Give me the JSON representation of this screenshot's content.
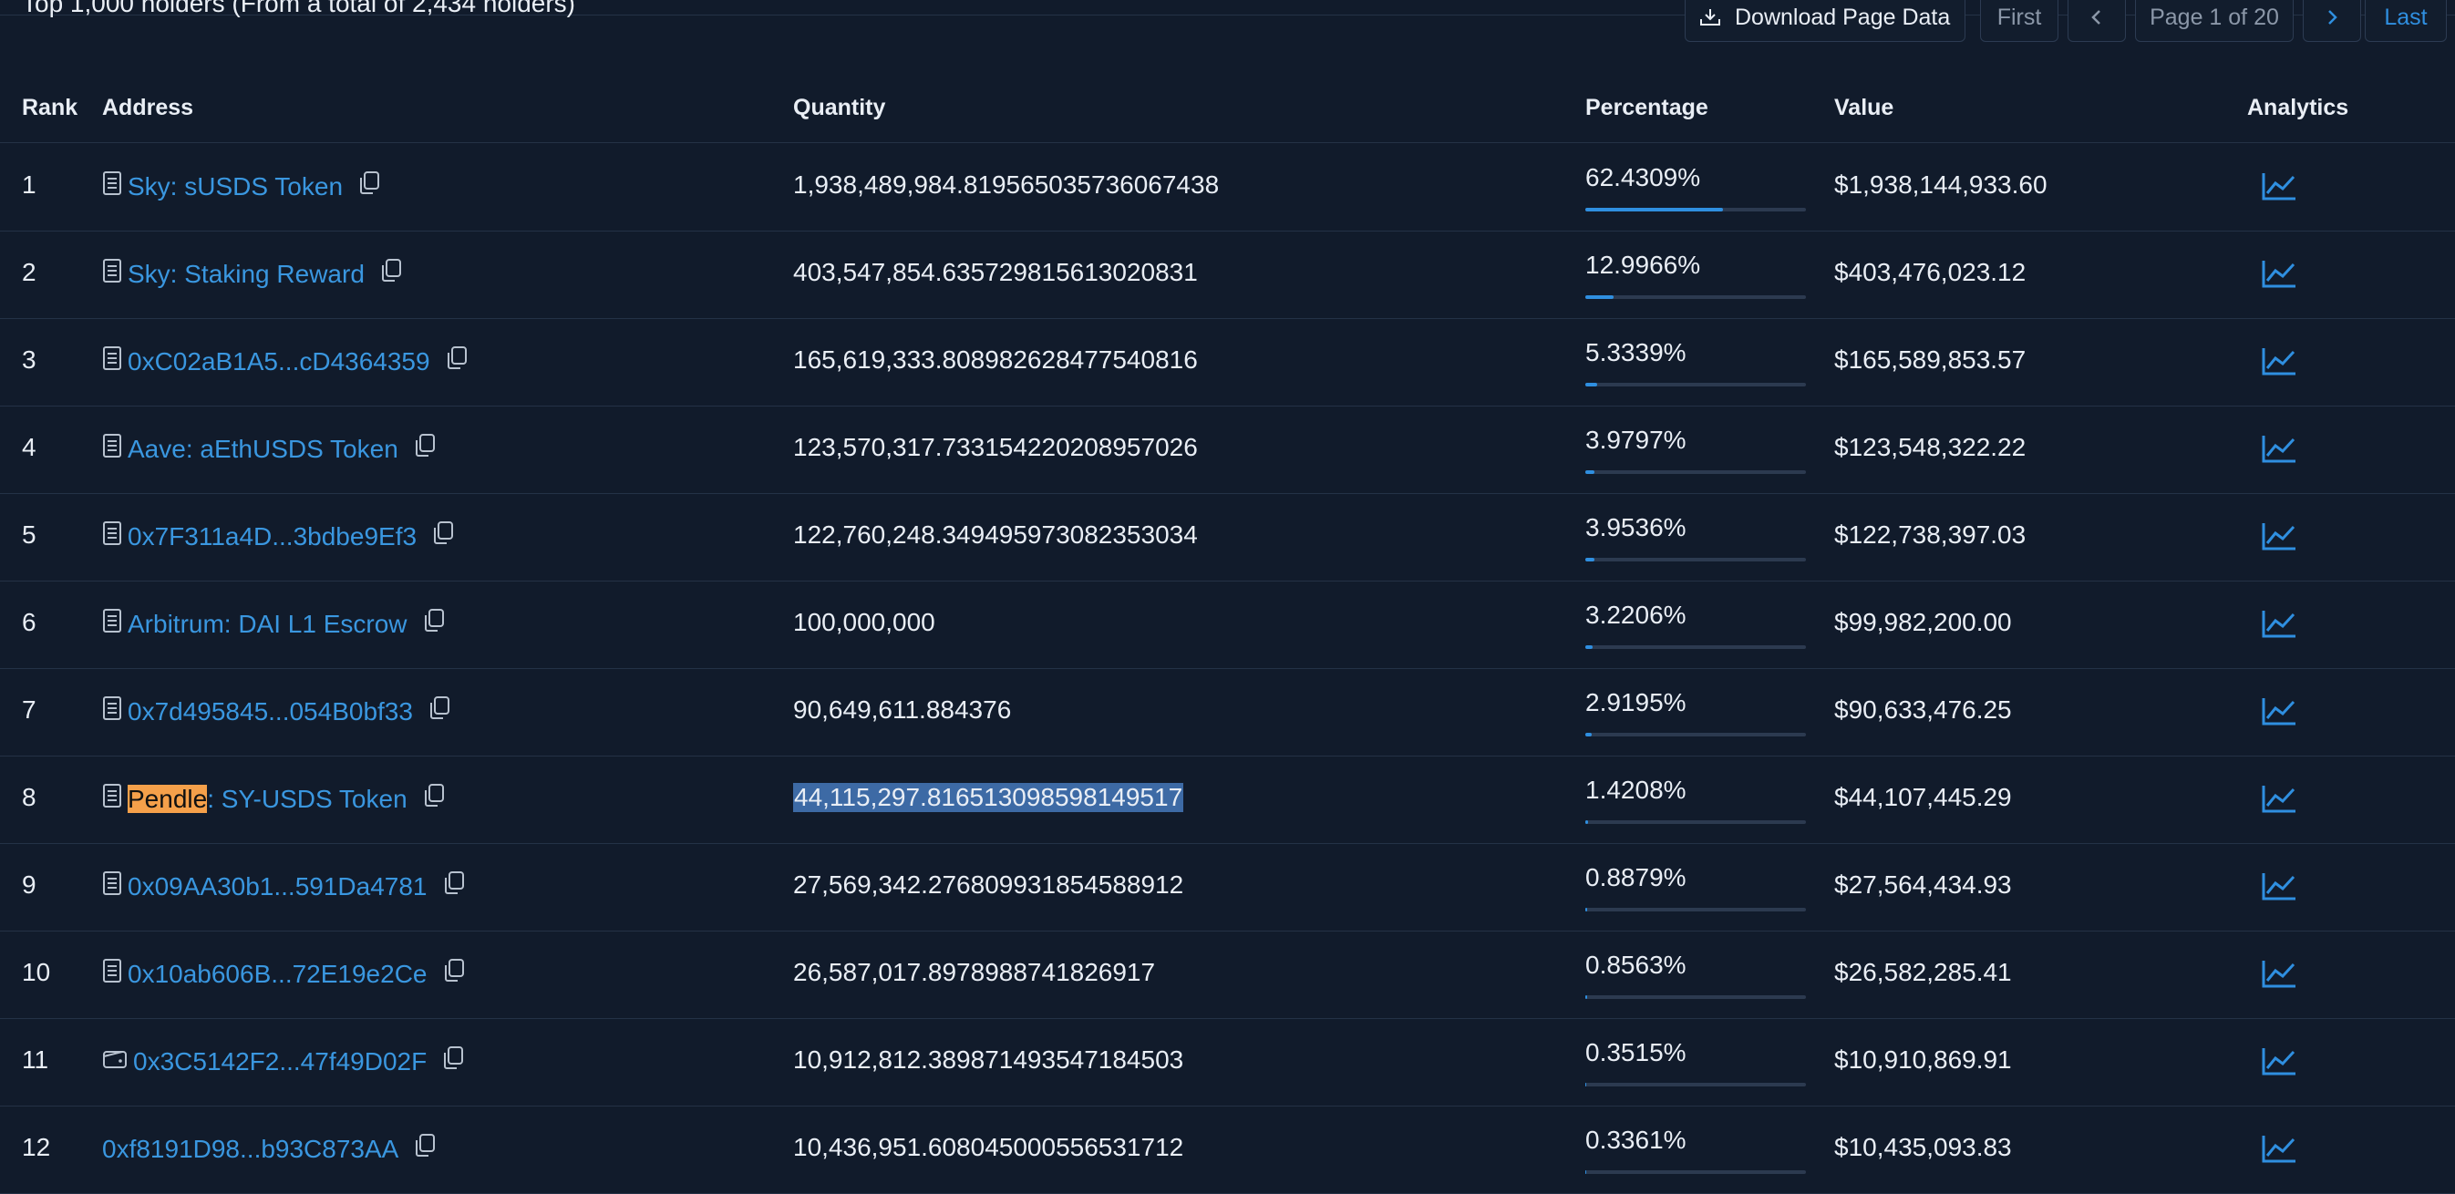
{
  "header": {
    "title": "Top 1,000 holders (From a total of 2,434 holders)",
    "download_label": "Download Page Data",
    "first_label": "First",
    "page_label": "Page 1 of 20",
    "last_label": "Last"
  },
  "columns": {
    "rank": "Rank",
    "address": "Address",
    "quantity": "Quantity",
    "percentage": "Percentage",
    "value": "Value",
    "analytics": "Analytics"
  },
  "rows": [
    {
      "rank": "1",
      "icon": "contract-icon",
      "address": "Sky: sUSDS Token",
      "quantity": "1,938,489,984.819565035736067438",
      "percentage": "62.4309%",
      "pct": 62.4309,
      "value": "$1,938,144,933.60"
    },
    {
      "rank": "2",
      "icon": "contract-icon",
      "address": "Sky: Staking Reward",
      "quantity": "403,547,854.635729815613020831",
      "percentage": "12.9966%",
      "pct": 12.9966,
      "value": "$403,476,023.12"
    },
    {
      "rank": "3",
      "icon": "contract-icon",
      "address": "0xC02aB1A5...cD4364359",
      "quantity": "165,619,333.808982628477540816",
      "percentage": "5.3339%",
      "pct": 5.3339,
      "value": "$165,589,853.57"
    },
    {
      "rank": "4",
      "icon": "contract-icon",
      "address": "Aave: aEthUSDS Token",
      "quantity": "123,570,317.733154220208957026",
      "percentage": "3.9797%",
      "pct": 3.9797,
      "value": "$123,548,322.22"
    },
    {
      "rank": "5",
      "icon": "contract-icon",
      "address": "0x7F311a4D...3bdbe9Ef3",
      "quantity": "122,760,248.349495973082353034",
      "percentage": "3.9536%",
      "pct": 3.9536,
      "value": "$122,738,397.03"
    },
    {
      "rank": "6",
      "icon": "contract-icon",
      "address": "Arbitrum: DAI L1 Escrow",
      "quantity": "100,000,000",
      "percentage": "3.2206%",
      "pct": 3.2206,
      "value": "$99,982,200.00"
    },
    {
      "rank": "7",
      "icon": "contract-icon",
      "address": "0x7d495845...054B0bf33",
      "quantity": "90,649,611.884376",
      "percentage": "2.9195%",
      "pct": 2.9195,
      "value": "$90,633,476.25"
    },
    {
      "rank": "8",
      "icon": "contract-icon",
      "address_highlight": "Pendle",
      "address_rest": ": SY-USDS Token",
      "quantity": "44,115,297.816513098598149517",
      "selected": true,
      "percentage": "1.4208%",
      "pct": 1.4208,
      "value": "$44,107,445.29"
    },
    {
      "rank": "9",
      "icon": "contract-icon",
      "address": "0x09AA30b1...591Da4781",
      "quantity": "27,569,342.276809931854588912",
      "percentage": "0.8879%",
      "pct": 0.8879,
      "value": "$27,564,434.93"
    },
    {
      "rank": "10",
      "icon": "contract-icon",
      "address": "0x10ab606B...72E19e2Ce",
      "quantity": "26,587,017.8978988741826917",
      "percentage": "0.8563%",
      "pct": 0.8563,
      "value": "$26,582,285.41"
    },
    {
      "rank": "11",
      "icon": "wallet-icon",
      "address": "0x3C5142F2...47f49D02F",
      "quantity": "10,912,812.389871493547184503",
      "percentage": "0.3515%",
      "pct": 0.3515,
      "value": "$10,910,869.91"
    },
    {
      "rank": "12",
      "icon": "",
      "address": "0xf8191D98...b93C873AA",
      "quantity": "10,436,951.608045000556531712",
      "percentage": "0.3361%",
      "pct": 0.3361,
      "value": "$10,435,093.83"
    }
  ],
  "colors": {
    "background": "#111b2b",
    "link": "#3a97e0",
    "bar_fill": "#2f8fe0",
    "highlight": "#f5a04a",
    "selection": "#3d6aa5"
  }
}
